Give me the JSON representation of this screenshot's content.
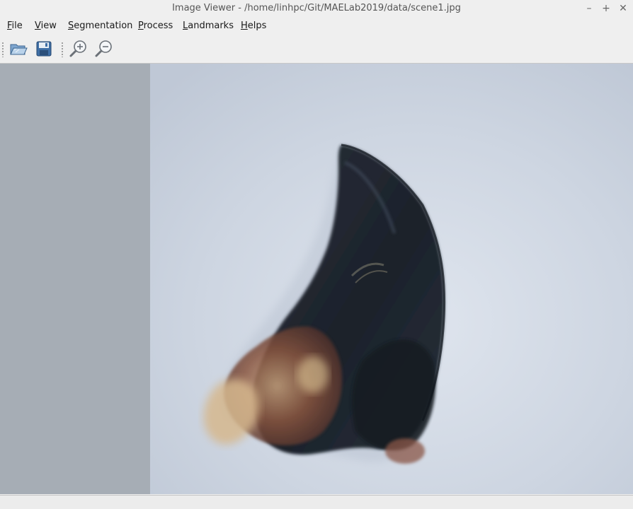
{
  "window": {
    "title": "Image Viewer - /home/linhpc/Git/MAELab2019/data/scene1.jpg",
    "controls": {
      "minimize": "–",
      "maximize": "+",
      "close": "✕"
    }
  },
  "menu": {
    "file": "File",
    "view": "View",
    "segmentation": "Segmentation",
    "process": "Process",
    "landmarks": "Landmarks",
    "helps": "Helps"
  },
  "toolbar": {
    "icons": [
      "open-folder-icon",
      "save-icon",
      "zoom-in-icon",
      "zoom-out-icon"
    ]
  },
  "colors": {
    "side_panel": "#a6adb5",
    "image_background": "#c9d1de",
    "specimen_dark": "#1f2630",
    "specimen_brown": "#7a4a3a",
    "specimen_tan": "#c8a882"
  },
  "status": {
    "text": ""
  }
}
